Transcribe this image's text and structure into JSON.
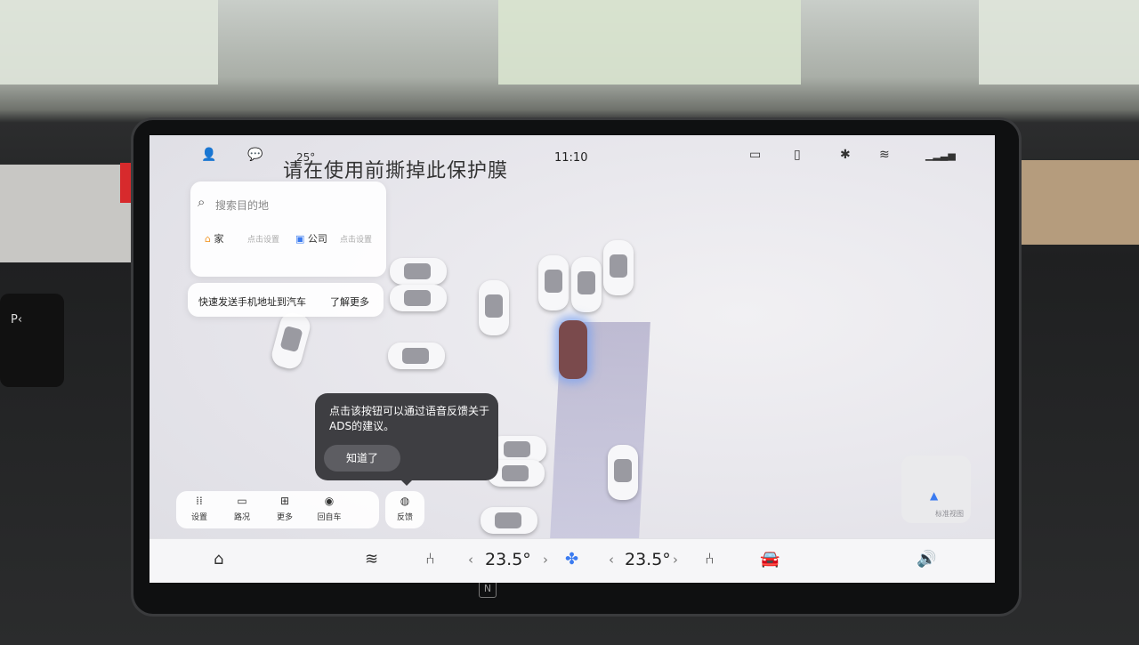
{
  "film_notice": "请在使用前撕掉此保护膜",
  "status_bar": {
    "time": "11:10",
    "temp_partial": "25°"
  },
  "search": {
    "placeholder": "搜索目的地",
    "home": "家",
    "home_hint": "点击设置",
    "work": "公司",
    "work_hint": "点击设置"
  },
  "send_card": {
    "text": "快速发送手机地址到汽车",
    "more": "了解更多"
  },
  "tooltip": {
    "text": "点击该按钮可以通过语音反馈关于ADS的建议。",
    "button": "知道了"
  },
  "toolbar": {
    "settings": "设置",
    "traffic": "路况",
    "more": "更多",
    "back_to_car": "回自车",
    "feedback": "反馈"
  },
  "minimap": {
    "label": "标准视图"
  },
  "dock": {
    "left_temp": "23.5°",
    "right_temp": "23.5°"
  },
  "colors": {
    "ego_glow": "#78a0f0",
    "dock_bg": "#f6f6f8",
    "tooltip_bg": "#3e3e42",
    "fan": "#3b7bf0"
  },
  "icons": [
    "user-icon",
    "message-icon",
    "camera-icon",
    "vibrate-icon",
    "bluetooth-off-icon",
    "wifi-icon",
    "signal-icon",
    "home-icon",
    "defrost-icon",
    "seat-icon",
    "fan-icon",
    "seat-heat-icon",
    "car-icon",
    "volume-icon"
  ]
}
